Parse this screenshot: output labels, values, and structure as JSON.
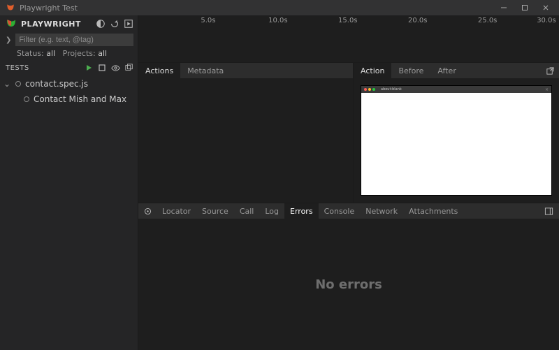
{
  "titlebar": {
    "title": "Playwright Test"
  },
  "sidebar": {
    "title": "PLAYWRIGHT",
    "filter_placeholder": "Filter (e.g. text, @tag)",
    "status_prefix": "Status:",
    "status_value": "all",
    "projects_prefix": "Projects:",
    "projects_value": "all",
    "tests_label": "TESTS",
    "tree": {
      "file": "contact.spec.js",
      "test": "Contact Mish and Max"
    }
  },
  "timeline": {
    "ticks": [
      "5.0s",
      "10.0s",
      "15.0s",
      "20.0s",
      "25.0s",
      "30.0s"
    ]
  },
  "actions_tabs": {
    "actions": "Actions",
    "metadata": "Metadata"
  },
  "preview_tabs": {
    "action": "Action",
    "before": "Before",
    "after": "After"
  },
  "preview_url": "about:blank",
  "bottom_tabs": {
    "locator": "Locator",
    "source": "Source",
    "call": "Call",
    "log": "Log",
    "errors": "Errors",
    "console": "Console",
    "network": "Network",
    "attachments": "Attachments"
  },
  "bottom_body": "No errors",
  "colors": {
    "traffic_red": "#ff5f57",
    "traffic_yellow": "#febc2e",
    "traffic_green": "#28c840",
    "play_green": "#4caf50"
  }
}
